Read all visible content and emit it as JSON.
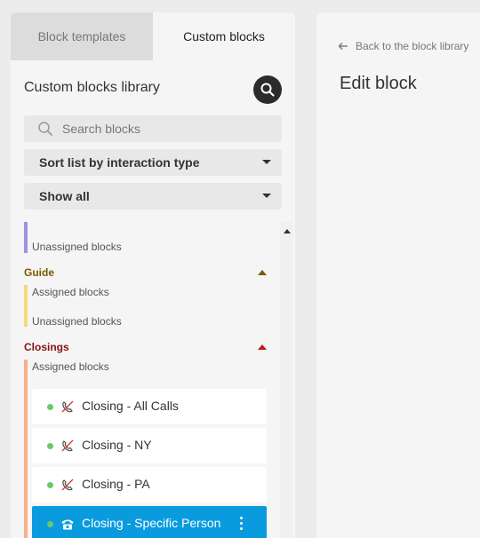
{
  "tabs": [
    {
      "label": "Block templates",
      "active": false
    },
    {
      "label": "Custom blocks",
      "active": true
    }
  ],
  "library": {
    "title": "Custom blocks library",
    "search_placeholder": "Search blocks",
    "sort_label": "Sort list by interaction type",
    "filter_label": "Show all"
  },
  "categories": [
    {
      "name": "",
      "color": "#9d94e0",
      "groups": [
        "Unassigned blocks"
      ]
    },
    {
      "name": "Guide",
      "color": "#f5d97a",
      "title_color": "#7a5a00",
      "groups": [
        "Assigned blocks",
        "Unassigned blocks"
      ]
    },
    {
      "name": "Closings",
      "color": "#f5b08c",
      "title_color": "#8b1212",
      "groups": [
        "Assigned blocks"
      ]
    }
  ],
  "blocks": [
    {
      "name": "Closing - All Calls",
      "icon": "hangup-phone-icon",
      "selected": false
    },
    {
      "name": "Closing - NY",
      "icon": "hangup-phone-icon",
      "selected": false
    },
    {
      "name": "Closing - PA",
      "icon": "hangup-phone-icon",
      "selected": false
    },
    {
      "name": "Closing - Specific Person",
      "icon": "desk-phone-icon",
      "selected": true
    }
  ],
  "editor": {
    "back_label": "Back to the block library",
    "title": "Edit block"
  },
  "colors": {
    "selected": "#0a9bdf",
    "status_dot": "#6bc86b",
    "guide_arrow": "#7a5a00",
    "closings_arrow": "#c01a1a"
  }
}
